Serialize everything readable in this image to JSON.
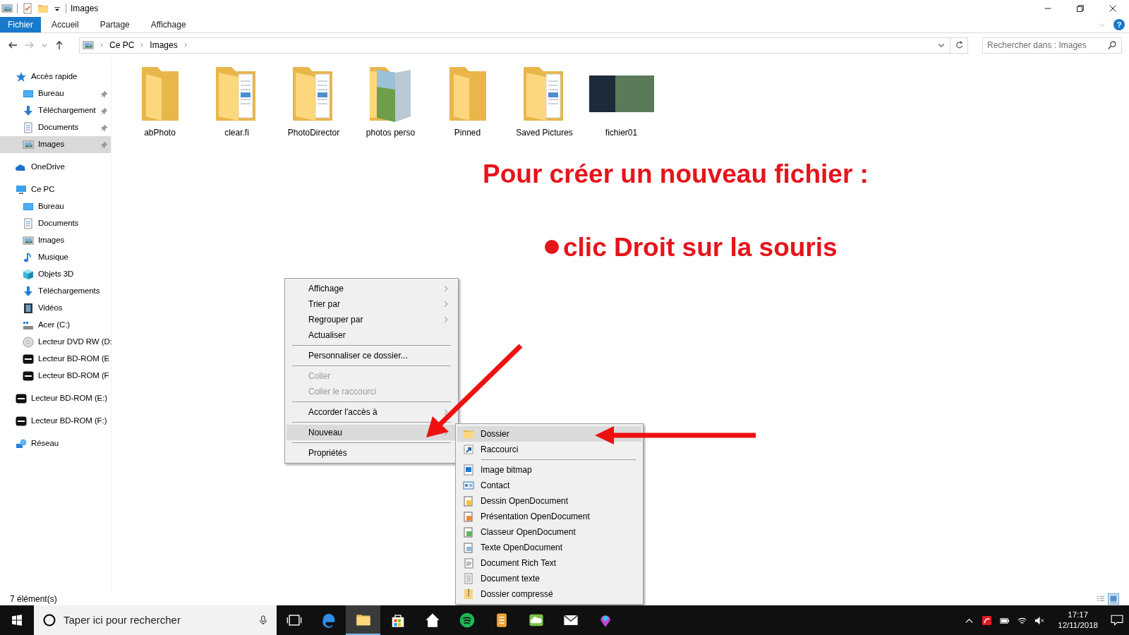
{
  "window": {
    "title": "Images"
  },
  "ribbon": {
    "tabs": [
      {
        "label": "Fichier",
        "selected": true
      },
      {
        "label": "Accueil",
        "selected": false
      },
      {
        "label": "Partage",
        "selected": false
      },
      {
        "label": "Affichage",
        "selected": false
      }
    ],
    "help": "?"
  },
  "address_bar": {
    "path": [
      "Ce PC",
      "Images"
    ]
  },
  "search": {
    "placeholder": "Rechercher dans : Images"
  },
  "sidebar": {
    "items": [
      {
        "label": "Accès rapide",
        "kind": "star",
        "selected": false,
        "pinned": false,
        "children": [
          {
            "label": "Bureau",
            "kind": "desktop",
            "selected": false,
            "pinned": true
          },
          {
            "label": "Téléchargement",
            "kind": "download",
            "selected": false,
            "pinned": true
          },
          {
            "label": "Documents",
            "kind": "document",
            "selected": false,
            "pinned": true
          },
          {
            "label": "Images",
            "kind": "picture",
            "selected": true,
            "pinned": true
          }
        ]
      },
      {
        "label": "OneDrive",
        "kind": "cloud",
        "selected": false,
        "pinned": false
      },
      {
        "label": "Ce PC",
        "kind": "computer",
        "selected": false,
        "pinned": false,
        "children": [
          {
            "label": "Bureau",
            "kind": "desktop",
            "selected": false,
            "pinned": false
          },
          {
            "label": "Documents",
            "kind": "document",
            "selected": false,
            "pinned": false
          },
          {
            "label": "Images",
            "kind": "picture",
            "selected": false,
            "pinned": false
          },
          {
            "label": "Musique",
            "kind": "music",
            "selected": false,
            "pinned": false
          },
          {
            "label": "Objets 3D",
            "kind": "cube",
            "selected": false,
            "pinned": false
          },
          {
            "label": "Téléchargements",
            "kind": "download",
            "selected": false,
            "pinned": false
          },
          {
            "label": "Vidéos",
            "kind": "film",
            "selected": false,
            "pinned": false
          },
          {
            "label": "Acer (C:)",
            "kind": "drive",
            "selected": false,
            "pinned": false
          },
          {
            "label": "Lecteur DVD RW (D:",
            "kind": "disc",
            "selected": false,
            "pinned": false
          },
          {
            "label": "Lecteur BD-ROM (E",
            "kind": "cdx",
            "selected": false,
            "pinned": false
          },
          {
            "label": "Lecteur BD-ROM (F",
            "kind": "cdx",
            "selected": false,
            "pinned": false
          }
        ]
      },
      {
        "label": "Lecteur BD-ROM (E:)",
        "kind": "cdx",
        "selected": false,
        "pinned": false
      },
      {
        "label": "Lecteur BD-ROM (F:)",
        "kind": "cdx",
        "selected": false,
        "pinned": false
      },
      {
        "label": "Réseau",
        "kind": "network",
        "selected": false,
        "pinned": false
      }
    ]
  },
  "files": [
    {
      "name": "abPhoto",
      "kind": "folder"
    },
    {
      "name": "clear.fi",
      "kind": "folder-docs"
    },
    {
      "name": "PhotoDirector",
      "kind": "folder-docs"
    },
    {
      "name": "photos perso",
      "kind": "folder-photo"
    },
    {
      "name": "Pinned",
      "kind": "folder"
    },
    {
      "name": "Saved Pictures",
      "kind": "folder-docs"
    },
    {
      "name": "fichier01",
      "kind": "thumbnail"
    }
  ],
  "annotation": {
    "title": "Pour créer un nouveau fichier :",
    "steps": [
      "clic Droit sur la souris"
    ]
  },
  "context_menu": {
    "groups": [
      [
        {
          "label": "Affichage",
          "submenu": true,
          "disabled": false,
          "selected": false
        },
        {
          "label": "Trier par",
          "submenu": true,
          "disabled": false,
          "selected": false
        },
        {
          "label": "Regrouper par",
          "submenu": true,
          "disabled": false,
          "selected": false
        },
        {
          "label": "Actualiser",
          "submenu": false,
          "disabled": false,
          "selected": false
        }
      ],
      [
        {
          "label": "Personnaliser ce dossier...",
          "submenu": false,
          "disabled": false,
          "selected": false
        }
      ],
      [
        {
          "label": "Coller",
          "submenu": false,
          "disabled": true,
          "selected": false
        },
        {
          "label": "Coller le raccourci",
          "submenu": false,
          "disabled": true,
          "selected": false
        }
      ],
      [
        {
          "label": "Accorder l'accès à",
          "submenu": true,
          "disabled": false,
          "selected": false
        }
      ],
      [
        {
          "label": "Nouveau",
          "submenu": true,
          "disabled": false,
          "selected": true
        }
      ],
      [
        {
          "label": "Propriétés",
          "submenu": false,
          "disabled": false,
          "selected": false
        }
      ]
    ]
  },
  "new_submenu": {
    "groups": [
      [
        {
          "label": "Dossier",
          "kind": "folder",
          "selected": true
        },
        {
          "label": "Raccourci",
          "kind": "shortcut",
          "selected": false
        }
      ],
      [
        {
          "label": "Image bitmap",
          "kind": "bitmap",
          "selected": false
        },
        {
          "label": "Contact",
          "kind": "contact",
          "selected": false
        },
        {
          "label": "Dessin OpenDocument",
          "kind": "odg",
          "selected": false
        },
        {
          "label": "Présentation OpenDocument",
          "kind": "odp",
          "selected": false
        },
        {
          "label": "Classeur OpenDocument",
          "kind": "ods",
          "selected": false
        },
        {
          "label": "Texte OpenDocument",
          "kind": "odt",
          "selected": false
        },
        {
          "label": "Document Rich Text",
          "kind": "rtf",
          "selected": false
        },
        {
          "label": "Document texte",
          "kind": "txt",
          "selected": false
        },
        {
          "label": "Dossier compressé",
          "kind": "zip",
          "selected": false
        }
      ]
    ]
  },
  "status_bar": {
    "count": "7 élément(s)",
    "views": [
      {
        "kind": "details",
        "selected": false
      },
      {
        "kind": "large-icons",
        "selected": true
      }
    ]
  },
  "taskbar": {
    "search_placeholder": "Taper ici pour rechercher",
    "apps": [
      {
        "kind": "task-view",
        "active": false
      },
      {
        "kind": "edge",
        "active": false
      },
      {
        "kind": "explorer",
        "active": true
      },
      {
        "kind": "store",
        "active": false
      },
      {
        "kind": "home",
        "active": false
      },
      {
        "kind": "spotify",
        "active": false
      },
      {
        "kind": "notes",
        "active": false
      },
      {
        "kind": "cloud-app",
        "active": false
      },
      {
        "kind": "mail",
        "active": false
      },
      {
        "kind": "maps",
        "active": false
      }
    ],
    "time": "17:17",
    "date": "12/11/2018"
  }
}
